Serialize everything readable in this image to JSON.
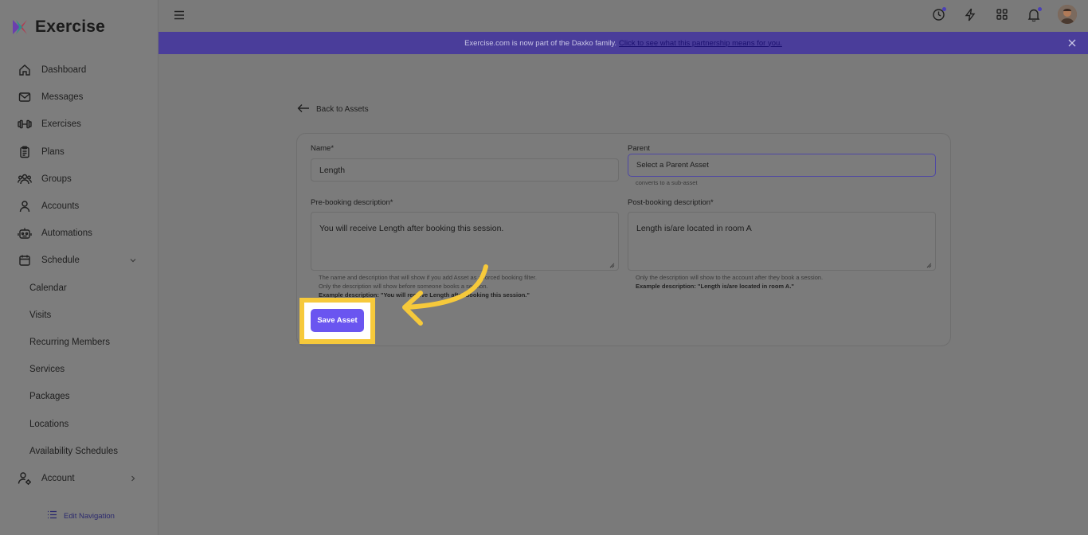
{
  "app": {
    "name": "Exercise",
    "brand_color": "#6a55f0",
    "highlight_color": "#f6c93b"
  },
  "sidebar": {
    "items": [
      {
        "label": "Dashboard",
        "icon": "home-icon"
      },
      {
        "label": "Messages",
        "icon": "mail-icon"
      },
      {
        "label": "Exercises",
        "icon": "dumbbell-icon"
      },
      {
        "label": "Plans",
        "icon": "clipboard-icon"
      },
      {
        "label": "Groups",
        "icon": "users-icon"
      },
      {
        "label": "Accounts",
        "icon": "user-icon"
      },
      {
        "label": "Automations",
        "icon": "robot-icon"
      },
      {
        "label": "Schedule",
        "icon": "calendar-icon",
        "expanded": true
      }
    ],
    "schedule_children": [
      "Calendar",
      "Visits",
      "Recurring Members",
      "Services",
      "Packages",
      "Locations",
      "Availability Schedules"
    ],
    "account": {
      "label": "Account",
      "icon": "user-gear-icon"
    },
    "edit_navigation": "Edit Navigation"
  },
  "banner": {
    "text": "Exercise.com is now part of the Daxko family.",
    "link": "Click to see what this partnership means for you."
  },
  "page": {
    "back_label": "Back to Assets",
    "form": {
      "name_label": "Name*",
      "name_value": "Length",
      "parent_label": "Parent",
      "parent_value": "Select a Parent Asset",
      "parent_help": "converts to a sub-asset",
      "pre_label": "Pre-booking description*",
      "pre_value": "You will receive Length after booking this session.",
      "pre_help_1": "The name and description that will show if you add Asset as a forced booking filter.",
      "pre_help_2": "Only the description will show before someone books a session.",
      "pre_help_3": "Example description: \"You will receive Length after booking this session.\"",
      "post_label": "Post-booking description*",
      "post_value": "Length is/are located in room A",
      "post_help_1": "Only the description will show to the account after they book a session.",
      "post_help_2": "Example description: \"Length is/are located in room A.\"",
      "save_label": "Save Asset"
    }
  }
}
